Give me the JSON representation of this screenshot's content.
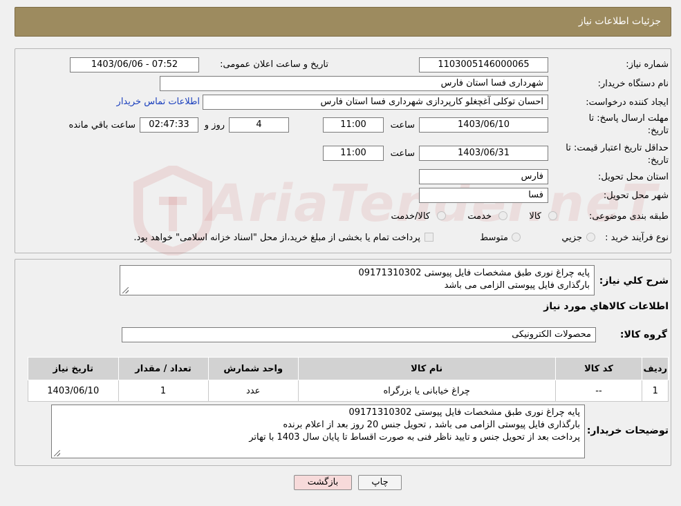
{
  "header": {
    "title": "جزئیات اطلاعات نیاز"
  },
  "fields": {
    "need_number_label": "شماره نیاز:",
    "need_number": "1103005146000065",
    "announce_label": "تاریخ و ساعت اعلان عمومی:",
    "announce_value": "1403/06/06 - 07:52",
    "buyer_org_label": "نام دستگاه خریدار:",
    "buyer_org": "شهرداری فسا استان فارس",
    "creator_label": "ایجاد کننده درخواست:",
    "creator": "احسان توکلی آغچغلو کارپردازی شهرداری فسا استان فارس",
    "contact_link": "اطلاعات تماس خریدار",
    "reply_deadline_label_1": "مهلت ارسال پاسخ: تا",
    "reply_deadline_label_2": "تاریخ:",
    "reply_date": "1403/06/10",
    "time_label": "ساعت",
    "reply_time": "11:00",
    "days_value": "4",
    "days_label": "روز و",
    "remaining_time": "02:47:33",
    "remaining_label": "ساعت باقي مانده",
    "price_validity_label_1": "حداقل تاریخ اعتبار قیمت: تا",
    "price_validity_label_2": "تاریخ:",
    "price_date": "1403/06/31",
    "price_time": "11:00",
    "province_label": "استان محل تحویل:",
    "province": "فارس",
    "city_label": "شهر محل تحویل:",
    "city": "فسا",
    "category_label": "طبقه بندی موضوعی:",
    "category_options": [
      "کالا",
      "خدمت",
      "کالا/خدمت"
    ],
    "purchase_type_label": "نوع فرآیند خرید :",
    "purchase_options": [
      "جزيي",
      "متوسط"
    ],
    "purchase_note": "پرداخت تمام یا بخشی از مبلغ خرید،از محل \"اسناد خزانه اسلامی\" خواهد بود."
  },
  "summary": {
    "general_desc_label": "شرح کلي نياز:",
    "general_desc_lines": [
      "پایه چراغ نوری طبق مشخصات فایل پیوستی 09171310302",
      "بارگذاری فایل پیوستی الزامی می باشد"
    ],
    "goods_info_title": "اطلاعات کالاهاي مورد نياز",
    "goods_group_label": "گروه کالا:",
    "goods_group": "محصولات الکترونیکی"
  },
  "table": {
    "headers": [
      "رديف",
      "کد کالا",
      "نام کالا",
      "واحد شمارش",
      "تعداد / مقدار",
      "تاريخ نياز"
    ],
    "rows": [
      [
        "1",
        "--",
        "چراغ خیابانی یا بزرگراه",
        "عدد",
        "1",
        "1403/06/10"
      ]
    ]
  },
  "buyer_notes": {
    "label": "توضیحات خریدار:",
    "lines": [
      "پایه چراغ نوری طبق مشخصات فایل پیوستی 09171310302",
      "بارگذاری فایل پیوستی الزامی می باشد , تحویل جنس 20 روز بعد از اعلام برنده",
      "پرداخت بعد از تحویل جنس  و تایید ناظر فنی به صورت اقساط تا پایان سال 1403 با تهاتر"
    ]
  },
  "buttons": {
    "print": "چاپ",
    "back": "بازگشت"
  },
  "watermark": {
    "text": "AriaTender.neT"
  },
  "colors": {
    "title_bar": "#9d8b5f",
    "back_button": "#f7dada",
    "link": "#1a3fbd"
  }
}
